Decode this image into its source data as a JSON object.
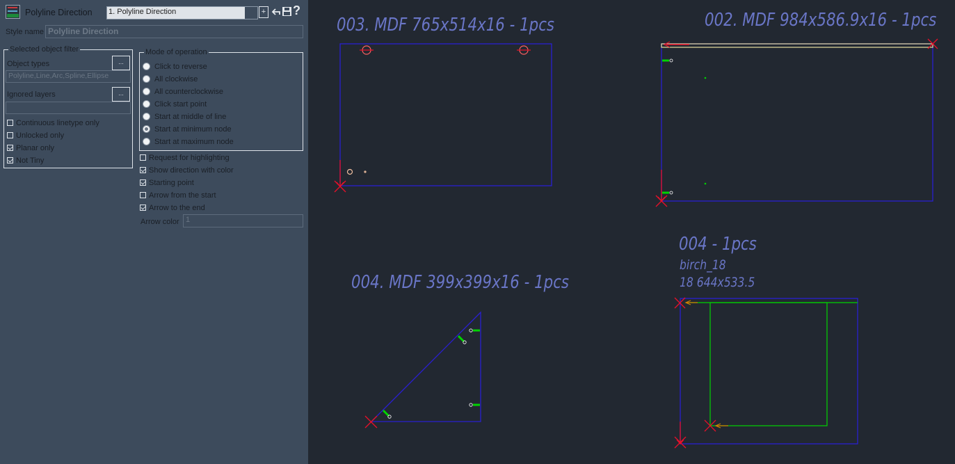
{
  "app": {
    "title": "Polyline Direction",
    "style_select_value": "1. Polyline Direction",
    "style_name_label": "Style name",
    "style_name_value": "Polyline Direction",
    "add_style_symbol": "+",
    "browse_symbol": "...",
    "icons": [
      "app-logo-icon",
      "back-arrow-icon",
      "save-icon",
      "help-icon"
    ]
  },
  "filter": {
    "group_label": "Selected object filter",
    "object_types_label": "Object types",
    "object_types_value": "Polyline,Line,Arc,Spline,Ellipse",
    "ignored_layers_label": "Ignored layers",
    "ignored_layers_value": "",
    "checkboxes": [
      {
        "label": "Continuous linetype only",
        "checked": false
      },
      {
        "label": "Unlocked only",
        "checked": false
      },
      {
        "label": "Planar only",
        "checked": true
      },
      {
        "label": "Not Tiny",
        "checked": true
      }
    ]
  },
  "mode": {
    "group_label": "Mode of operation",
    "options": [
      {
        "label": "Click to reverse",
        "selected": false
      },
      {
        "label": "All clockwise",
        "selected": false
      },
      {
        "label": "All counterclockwise",
        "selected": false
      },
      {
        "label": "Click start point",
        "selected": false
      },
      {
        "label": "Start at middle of line",
        "selected": false
      },
      {
        "label": "Start at minimum node",
        "selected": true
      },
      {
        "label": "Start at maximum node",
        "selected": false
      }
    ]
  },
  "display": {
    "checkboxes": [
      {
        "label": "Request for highlighting",
        "checked": false
      },
      {
        "label": "Show direction with color",
        "checked": true
      },
      {
        "label": "Starting point",
        "checked": true
      },
      {
        "label": "Arrow from the start",
        "checked": false
      },
      {
        "label": "Arrow to the end",
        "checked": true
      }
    ],
    "arrow_color_label": "Arrow color",
    "arrow_color_value": "1"
  },
  "drawing": {
    "labels": {
      "part_003": "003. MDF 765x514x16 - 1pcs",
      "part_002": "002. MDF 984x586.9x16 - 1pcs",
      "part_004a": "004. MDF 399x399x16 - 1pcs",
      "part_004b_title": "004 - 1pcs",
      "part_004b_material": "birch_18",
      "part_004b_size": "18 644x533.5"
    },
    "colors": {
      "outline": "#2a1fd0",
      "marker": "#e8102a",
      "direction": "#00d400",
      "highlight": "#e8e0a0",
      "text": "#6a76c7"
    }
  }
}
